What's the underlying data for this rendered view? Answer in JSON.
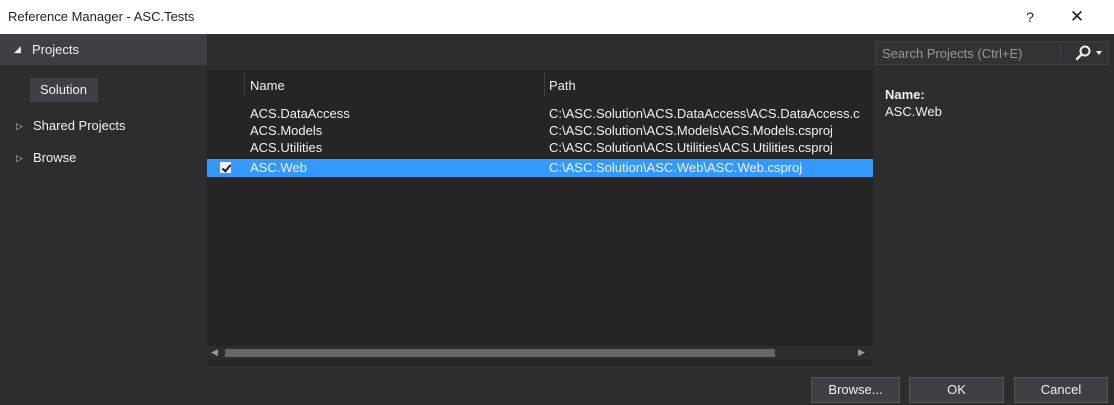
{
  "window": {
    "title": "Reference Manager - ASC.Tests",
    "help_label": "?",
    "close_label": "✕"
  },
  "sidebar": {
    "header": {
      "label": "Projects",
      "expanded": true
    },
    "solution_label": "Solution",
    "items": [
      {
        "label": "Shared Projects",
        "expanded": false
      },
      {
        "label": "Browse",
        "expanded": false
      }
    ]
  },
  "list": {
    "columns": {
      "name": "Name",
      "path": "Path"
    },
    "rows": [
      {
        "name": "ACS.DataAccess",
        "path": "C:\\ASC.Solution\\ACS.DataAccess\\ACS.DataAccess.c",
        "checked": false,
        "selected": false
      },
      {
        "name": "ACS.Models",
        "path": "C:\\ASC.Solution\\ACS.Models\\ACS.Models.csproj",
        "checked": false,
        "selected": false
      },
      {
        "name": "ACS.Utilities",
        "path": "C:\\ASC.Solution\\ACS.Utilities\\ACS.Utilities.csproj",
        "checked": false,
        "selected": false
      },
      {
        "name": "ASC.Web",
        "path": "C:\\ASC.Solution\\ASC.Web\\ASC.Web.csproj",
        "checked": true,
        "selected": true
      }
    ]
  },
  "search": {
    "placeholder": "Search Projects (Ctrl+E)",
    "icon": "search-icon"
  },
  "details": {
    "label": "Name:",
    "value": "ASC.Web"
  },
  "footer": {
    "browse_label": "Browse...",
    "ok_label": "OK",
    "cancel_label": "Cancel"
  },
  "colors": {
    "selection": "#3399ff",
    "background": "#252526",
    "panel": "#2d2d30",
    "accent_header": "#3f3f46"
  }
}
